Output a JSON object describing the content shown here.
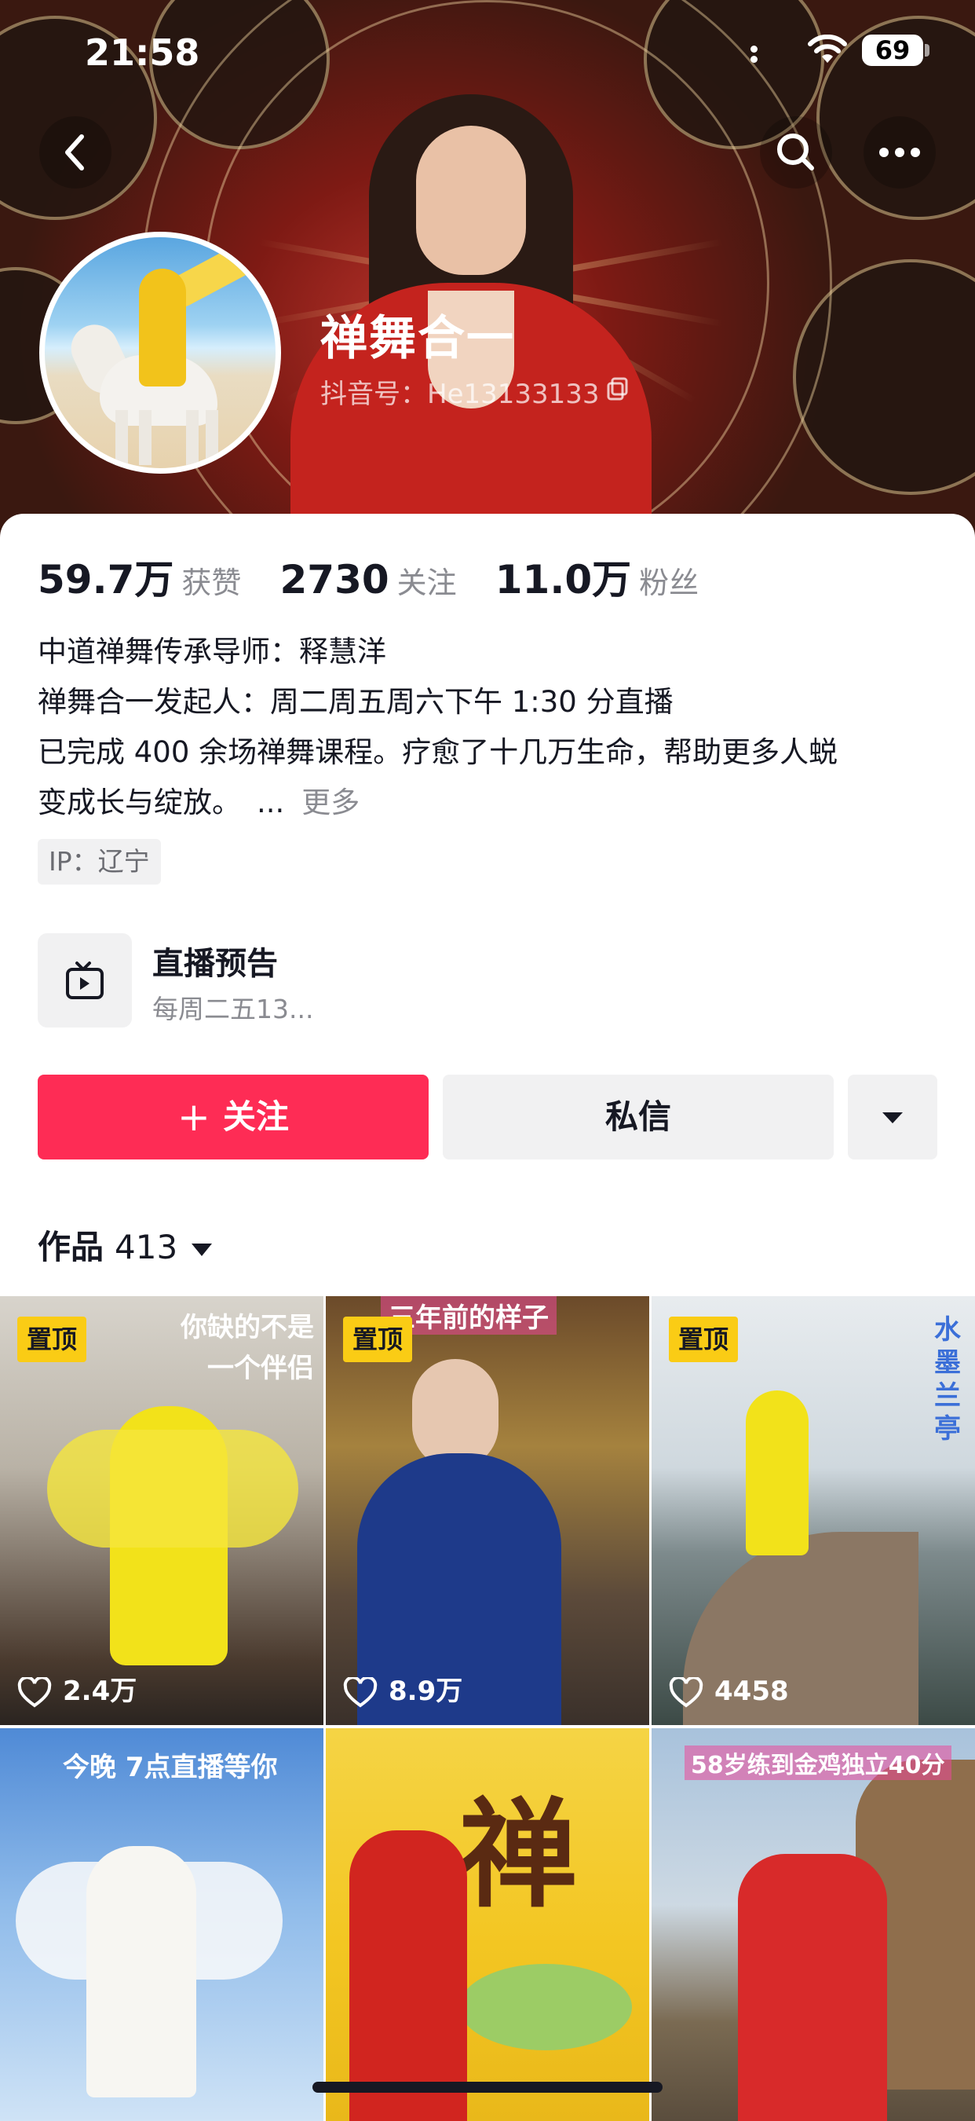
{
  "status_bar": {
    "time": "21:58",
    "battery": "69"
  },
  "profile": {
    "nickname": "禅舞合一",
    "douyin_id": "抖音号：He13133133"
  },
  "stats": [
    {
      "value": "59.7万",
      "label": "获赞"
    },
    {
      "value": "2730",
      "label": "关注"
    },
    {
      "value": "11.0万",
      "label": "粉丝"
    }
  ],
  "bio": {
    "line1": "中道禅舞传承导师：释慧洋",
    "line2": "禅舞合一发起人：周二周五周六下午 1:30 分直播",
    "line3": "已完成 400 余场禅舞课程。疗愈了十几万生命，帮助更多人蜕",
    "line4": "变成长与绽放。",
    "ellipsis": "...",
    "more": "更多"
  },
  "ip_tag": "IP：辽宁",
  "live_notice": {
    "title": "直播预告",
    "subtitle": "每周二五13..."
  },
  "buttons": {
    "follow_plus": "+",
    "follow": "关注",
    "message": "私信"
  },
  "works_tab": {
    "label": "作品",
    "count": "413"
  },
  "videos": [
    {
      "pinned": "置顶",
      "likes": "2.4万",
      "caption": "你缺的不是\n一个伴侣"
    },
    {
      "pinned": "置顶",
      "likes": "8.9万",
      "caption": "三年前的样子"
    },
    {
      "pinned": "置顶",
      "likes": "4458",
      "caption": "水墨兰亭"
    },
    {
      "caption": "今晚 7点直播等你"
    },
    {
      "caption": "禅"
    },
    {
      "caption": "58岁练到金鸡独立40分"
    }
  ],
  "colors": {
    "primary": "#fe2c55",
    "pin_badge": "#facc15",
    "text": "#161823",
    "muted": "#8a8b91"
  }
}
